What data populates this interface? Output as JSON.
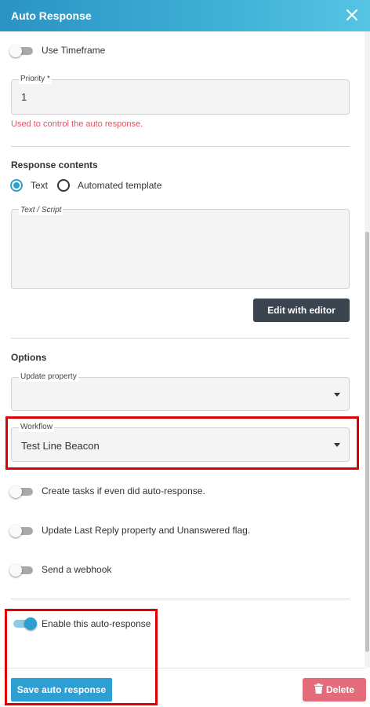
{
  "header": {
    "title": "Auto Response",
    "close_icon": "close-icon"
  },
  "timeframe": {
    "label": "Use Timeframe",
    "enabled": false
  },
  "priority": {
    "label": "Priority *",
    "value": "1",
    "helper": "Used to control the auto response."
  },
  "response_contents": {
    "title": "Response contents",
    "options": [
      {
        "label": "Text",
        "selected": true
      },
      {
        "label": "Automated template",
        "selected": false
      }
    ],
    "script_label": "Text / Script",
    "script_value": "",
    "editor_button": "Edit with editor"
  },
  "options": {
    "title": "Options",
    "update_property": {
      "label": "Update property",
      "value": ""
    },
    "workflow": {
      "label": "Workflow",
      "value": "Test Line Beacon"
    },
    "toggles": [
      {
        "label": "Create tasks if even did auto-response.",
        "enabled": false
      },
      {
        "label": "Update Last Reply property and Unanswered flag.",
        "enabled": false
      },
      {
        "label": "Send a webhook",
        "enabled": false
      }
    ]
  },
  "enable": {
    "label": "Enable this auto-response",
    "enabled": true
  },
  "footer": {
    "save_label": "Save auto response",
    "delete_label": "Delete"
  },
  "colors": {
    "accent": "#2d9fd2",
    "danger": "#e46b79",
    "highlight": "#e00000",
    "dark_button": "#3b4550"
  }
}
